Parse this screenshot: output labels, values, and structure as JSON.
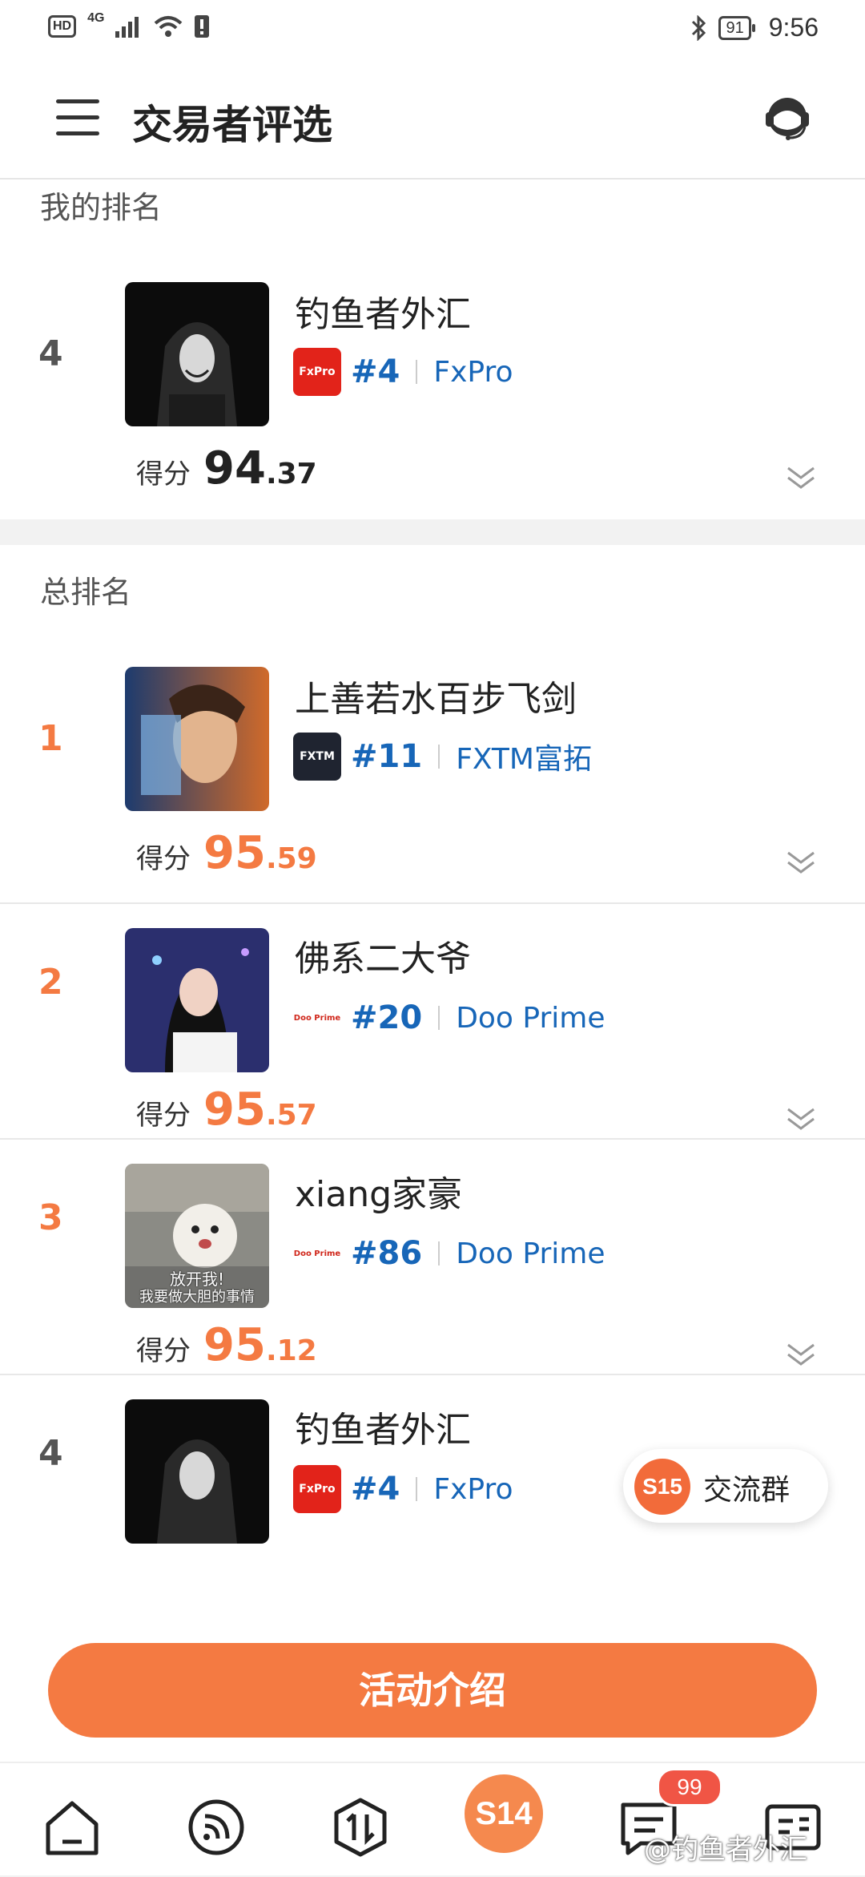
{
  "status_bar": {
    "hd": "HD",
    "network": "4G",
    "battery": "91",
    "time": "9:56"
  },
  "header": {
    "title": "交易者评选"
  },
  "my_ranking": {
    "section_title": "我的排名",
    "entry": {
      "rank": "4",
      "name": "钓鱼者外汇",
      "broker_logo": "FxPro",
      "broker_rank": "#4",
      "broker": "FxPro",
      "score_label": "得分",
      "score_int": "94",
      "score_dec": ".37"
    }
  },
  "overall_ranking": {
    "section_title": "总排名",
    "entries": [
      {
        "rank": "1",
        "name": "上善若水百步飞剑",
        "broker_logo": "FXTM",
        "broker_rank": "#11",
        "broker": "FXTM富拓",
        "score_label": "得分",
        "score_int": "95",
        "score_dec": ".59"
      },
      {
        "rank": "2",
        "name": "佛系二大爷",
        "broker_logo": "Doo Prime",
        "broker_rank": "#20",
        "broker": "Doo Prime",
        "score_label": "得分",
        "score_int": "95",
        "score_dec": ".57"
      },
      {
        "rank": "3",
        "name": "xiang家豪",
        "broker_logo": "Doo Prime",
        "broker_rank": "#86",
        "broker": "Doo Prime",
        "score_label": "得分",
        "score_int": "95",
        "score_dec": ".12",
        "avatar_caption_1": "放开我!",
        "avatar_caption_2": "我要做大胆的事情"
      },
      {
        "rank": "4",
        "name": "钓鱼者外汇",
        "broker_logo": "FxPro",
        "broker_rank": "#4",
        "broker": "FxPro"
      }
    ]
  },
  "floating_group": {
    "badge": "S15",
    "label": "交流群"
  },
  "cta": {
    "label": "活动介绍"
  },
  "tabbar": {
    "items": [
      "home-icon",
      "feed-icon",
      "trade-icon",
      "S14",
      "message-icon",
      "profile-icon"
    ],
    "center_label": "S14",
    "message_badge": "99"
  },
  "watermark": "@钓鱼者外汇",
  "colors": {
    "accent": "#f47a42",
    "link": "#1766b8",
    "badge_red": "#f05545"
  }
}
